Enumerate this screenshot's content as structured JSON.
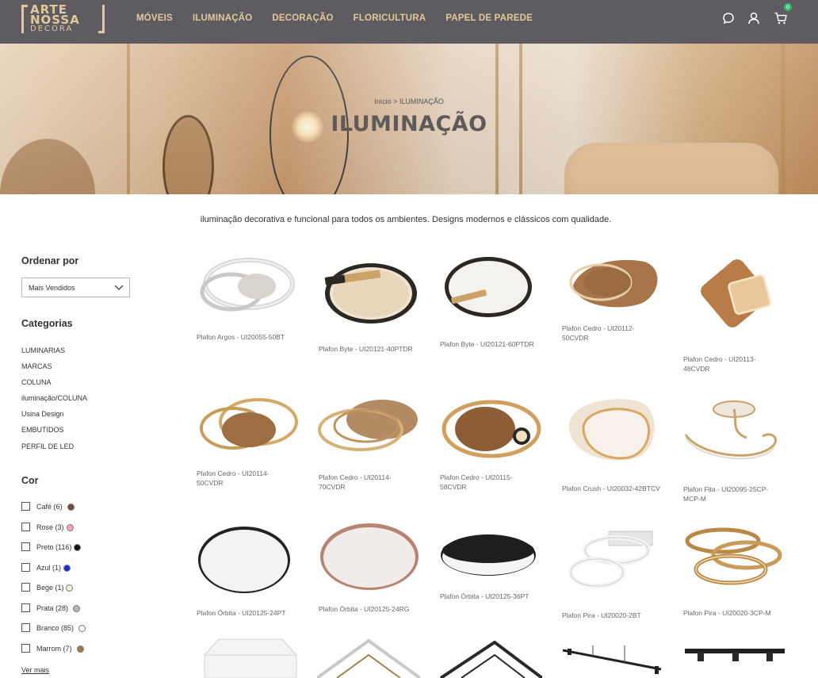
{
  "header": {
    "logo": {
      "line1": "ARTE",
      "line2": "NOSSA",
      "line3": "DECORA"
    },
    "nav": [
      "MÓVEIS",
      "ILUMINAÇÃO",
      "DECORAÇÃO",
      "FLORICULTURA",
      "PAPEL DE PAREDE"
    ],
    "cart_count": "0",
    "icons": [
      "chat-icon",
      "user-icon",
      "cart-icon"
    ]
  },
  "hero": {
    "breadcrumb": "Início > ILUMINAÇÃO",
    "title": "ILUMINAÇÃO"
  },
  "description": "iluminação decorativa e funcional para todos os ambientes. Designs modernos e clássicos com qualidade.",
  "sidebar": {
    "sort_heading": "Ordenar por",
    "sort_value": "Mais Vendidos",
    "categories_heading": "Categorias",
    "categories": [
      "LUMINARIAS",
      "MARCAS",
      "COLUNA",
      "iluminação/COLUNA",
      "Usina Design",
      "EMBUTIDOS",
      "PERFIL DE LED"
    ],
    "color_heading": "Cor",
    "colors": [
      {
        "label": "Café (6)",
        "color": "#6b4d3c"
      },
      {
        "label": "Rose (3)",
        "color": "#f2a9b7"
      },
      {
        "label": "Preto (116)",
        "color": "#111111"
      },
      {
        "label": "Azul (1)",
        "color": "#1c2bd8"
      },
      {
        "label": "Bege (1)",
        "color": "#f4f0d8"
      },
      {
        "label": "Prata (28)",
        "color": "#b5b5b5"
      },
      {
        "label": "Branco (85)",
        "color": "#ffffff"
      },
      {
        "label": "Marrom (7)",
        "color": "#a07a46"
      }
    ],
    "see_more": "Ver mais"
  },
  "products": [
    {
      "name": "Plafon Argos - UI20055-50BT"
    },
    {
      "name": "Plafon Byte - UI20121-40PTDR"
    },
    {
      "name": "Plafon Byte - UI20121-60PTDR"
    },
    {
      "name": "Plafon Cedro - UI20112-50CVDR"
    },
    {
      "name": "Plafon Cedro - UI20113-48CVDR"
    },
    {
      "name": "Plafon Cedro - UI20114-50CVDR"
    },
    {
      "name": "Plafon Cedro - UI20114-70CVDR"
    },
    {
      "name": "Plafon Cedro - UI20115-58CVDR"
    },
    {
      "name": "Plafon Crush - UI20032-42BTCV"
    },
    {
      "name": "Plafon Fita - UI20095-25CP-MCP-M"
    },
    {
      "name": "Plafon Órbita - UI20125-24PT"
    },
    {
      "name": "Plafon Órbita - UI20125-24RG"
    },
    {
      "name": "Plafon Órbita - UI20125-36PT"
    },
    {
      "name": "Plafon Pira - UI20020-2BT"
    },
    {
      "name": "Plafon Pira - UI20020-3CP-M"
    }
  ]
}
